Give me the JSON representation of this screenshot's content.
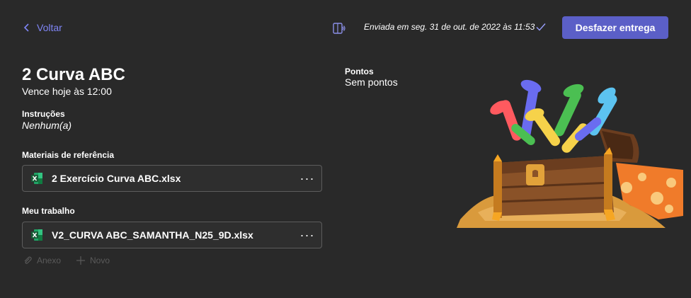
{
  "header": {
    "back_label": "Voltar",
    "submitted_text": "Enviada em seg. 31 de out. de 2022 às 11:53",
    "undo_button_label": "Desfazer entrega"
  },
  "assignment": {
    "title": "2 Curva ABC",
    "due": "Vence hoje às 12:00",
    "instructions_label": "Instruções",
    "instructions_value": "Nenhum(a)",
    "reference_label": "Materiais de referência",
    "reference_file": "2 Exercício Curva ABC.xlsx",
    "my_work_label": "Meu trabalho",
    "my_work_file": "V2_CURVA ABC_SAMANTHA_N25_9D.xlsx",
    "attach_label": "Anexo",
    "new_label": "Novo"
  },
  "points": {
    "label": "Pontos",
    "value": "Sem pontos"
  },
  "icons": {
    "back": "chevron-left-icon",
    "reader": "immersive-reader-icon",
    "check": "checkmark-icon",
    "excel": "excel-file-icon",
    "more": "more-options-icon",
    "attach": "paperclip-icon",
    "new": "plus-icon"
  },
  "colors": {
    "background": "#292929",
    "accent": "#5b5fc7",
    "link": "#7f85f5",
    "excel_green": "#1d6f42"
  }
}
